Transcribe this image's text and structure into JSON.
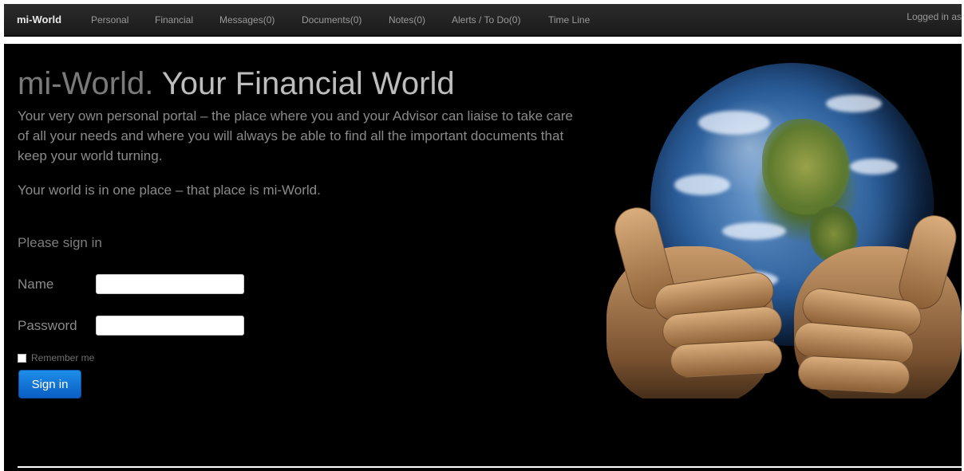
{
  "navbar": {
    "brand": "mi-World",
    "items": [
      {
        "label": "Personal"
      },
      {
        "label": "Financial"
      },
      {
        "label": "Messages(0)"
      },
      {
        "label": "Documents(0)"
      },
      {
        "label": "Notes(0)"
      },
      {
        "label": "Alerts / To Do(0)"
      },
      {
        "label": "Time Line"
      }
    ],
    "logged_in": "Logged in as"
  },
  "hero": {
    "title_part1": "mi-World.",
    "title_part2": "Your Financial World",
    "intro": "Your very own personal portal – the place where you and your Advisor can liaise to take care of all your needs and where you will always be able to find all the important documents that keep your world turning.",
    "tagline": "Your world is in one place – that place is mi-World."
  },
  "signin": {
    "title": "Please sign in",
    "name_label": "Name",
    "name_value": "",
    "password_label": "Password",
    "password_value": "",
    "remember_label": "Remember me",
    "remember_checked": false,
    "button_label": "Sign in"
  },
  "image": {
    "icon": "globe-in-hands-image"
  },
  "colors": {
    "background": "#000000",
    "navbar": "#222222",
    "button": "#0b6cd6"
  }
}
